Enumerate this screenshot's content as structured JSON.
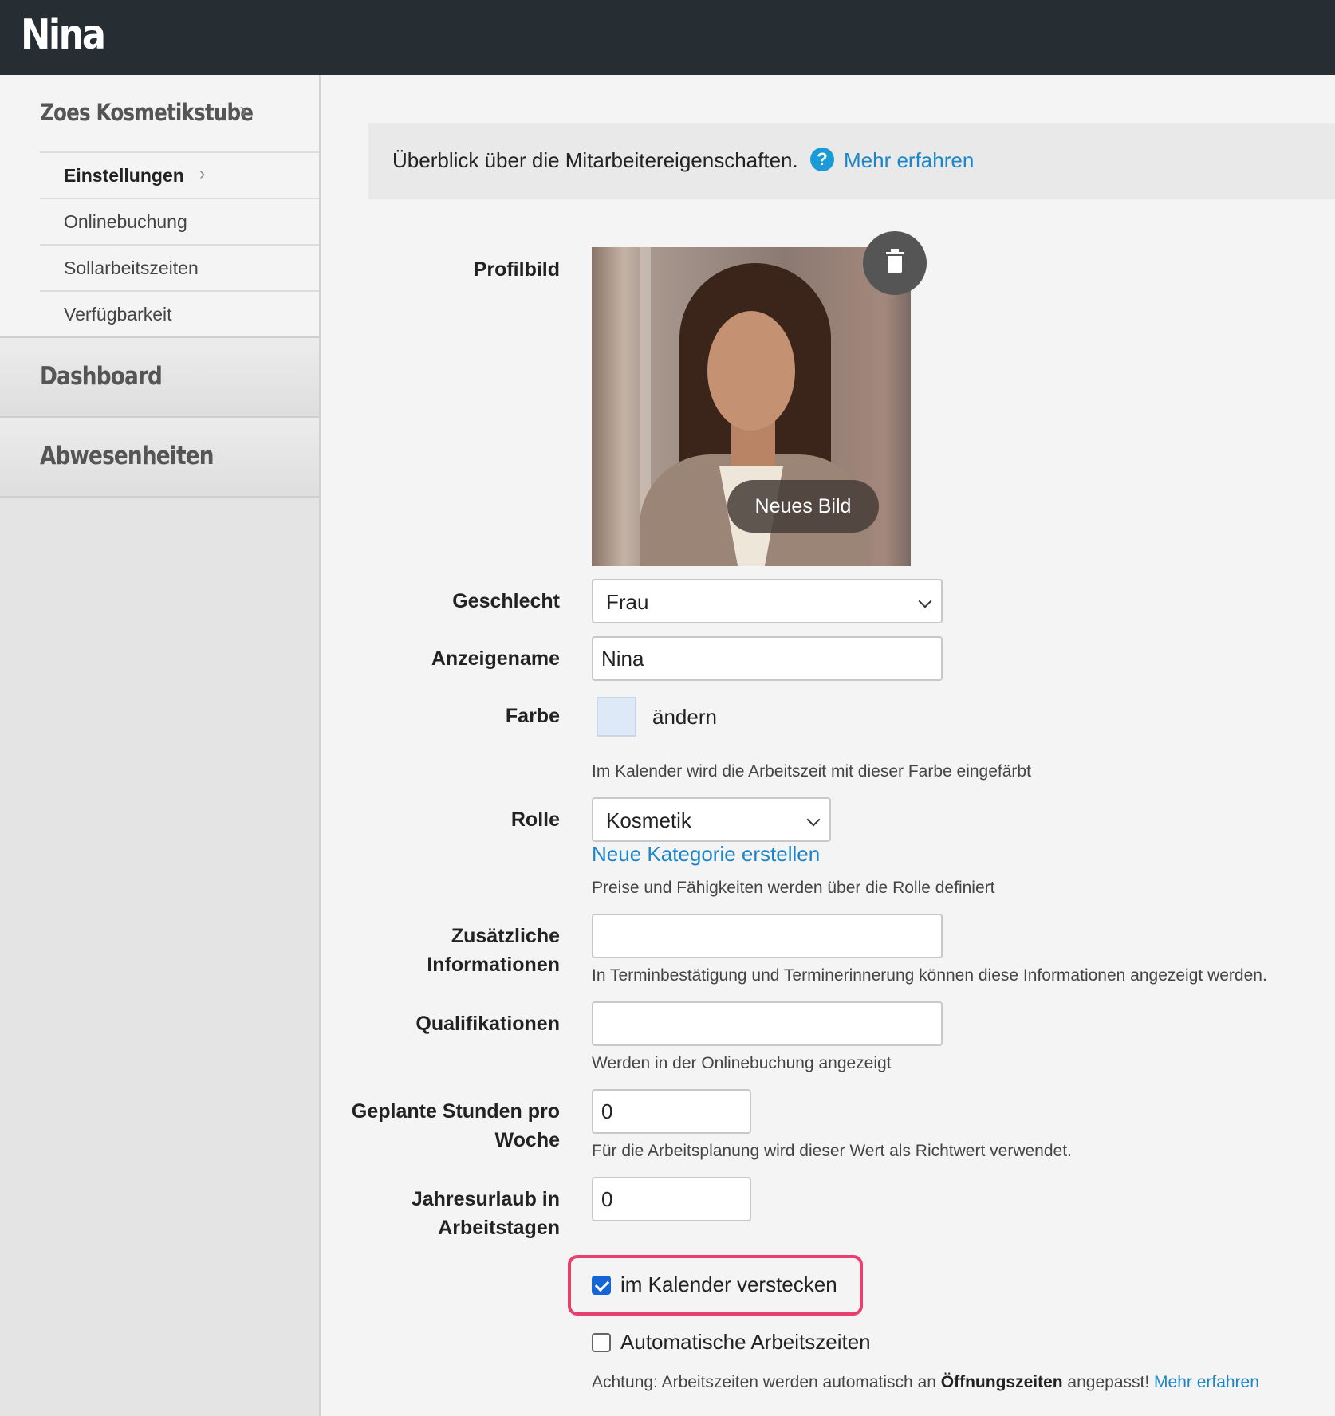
{
  "header": {
    "title": "Nina"
  },
  "sidebar": {
    "brand": "Zoes Kosmetikstube",
    "submenu": [
      {
        "label": "Einstellungen",
        "active": true
      },
      {
        "label": "Onlinebuchung"
      },
      {
        "label": "Sollarbeitszeiten"
      },
      {
        "label": "Verfügbarkeit"
      }
    ],
    "main_items": [
      {
        "label": "Dashboard"
      },
      {
        "label": "Abwesenheiten"
      }
    ]
  },
  "info": {
    "text": "Überblick über die Mitarbeitereigenschaften.",
    "help_icon": "question-circle-icon",
    "link": "Mehr erfahren"
  },
  "form": {
    "profile_label": "Profilbild",
    "new_image_label": "Neues Bild",
    "delete_icon": "trash-icon",
    "gender_label": "Geschlecht",
    "gender_value": "Frau",
    "display_name_label": "Anzeigename",
    "display_name_value": "Nina",
    "color_label": "Farbe",
    "color_value": "#dde9f6",
    "color_change": "ändern",
    "color_help": "Im Kalender wird die Arbeitszeit mit dieser Farbe eingefärbt",
    "role_label": "Rolle",
    "role_value": "Kosmetik",
    "role_new_link": "Neue Kategorie erstellen",
    "role_help": "Preise und Fähigkeiten werden über die Rolle definiert",
    "extra_info_label_1": "Zusätzliche",
    "extra_info_label_2": "Informationen",
    "extra_info_value": "",
    "extra_info_help": "In Terminbestätigung und Terminerinnerung können diese Informationen angezeigt werden.",
    "qualifications_label": "Qualifikationen",
    "qualifications_value": "",
    "qualifications_help": "Werden in der Onlinebuchung angezeigt",
    "hours_label_1": "Geplante Stunden pro",
    "hours_label_2": "Woche",
    "hours_value": "0",
    "hours_help": "Für die Arbeitsplanung wird dieser Wert als Richtwert verwendet.",
    "vacation_label_1": "Jahresurlaub in",
    "vacation_label_2": "Arbeitstagen",
    "vacation_value": "0",
    "hide_calendar_label": "im Kalender verstecken",
    "hide_calendar_checked": true,
    "auto_hours_label": "Automatische Arbeitszeiten",
    "auto_hours_checked": false,
    "warning_prefix": "Achtung: Arbeitszeiten werden automatisch an ",
    "warning_bold": "Öffnungszeiten",
    "warning_suffix": " angepasst! ",
    "warning_link": "Mehr erfahren"
  },
  "colors": {
    "header_bg": "#262d33",
    "link": "#1a86c9",
    "highlight": "#e8406e",
    "checkbox": "#1565d8"
  }
}
